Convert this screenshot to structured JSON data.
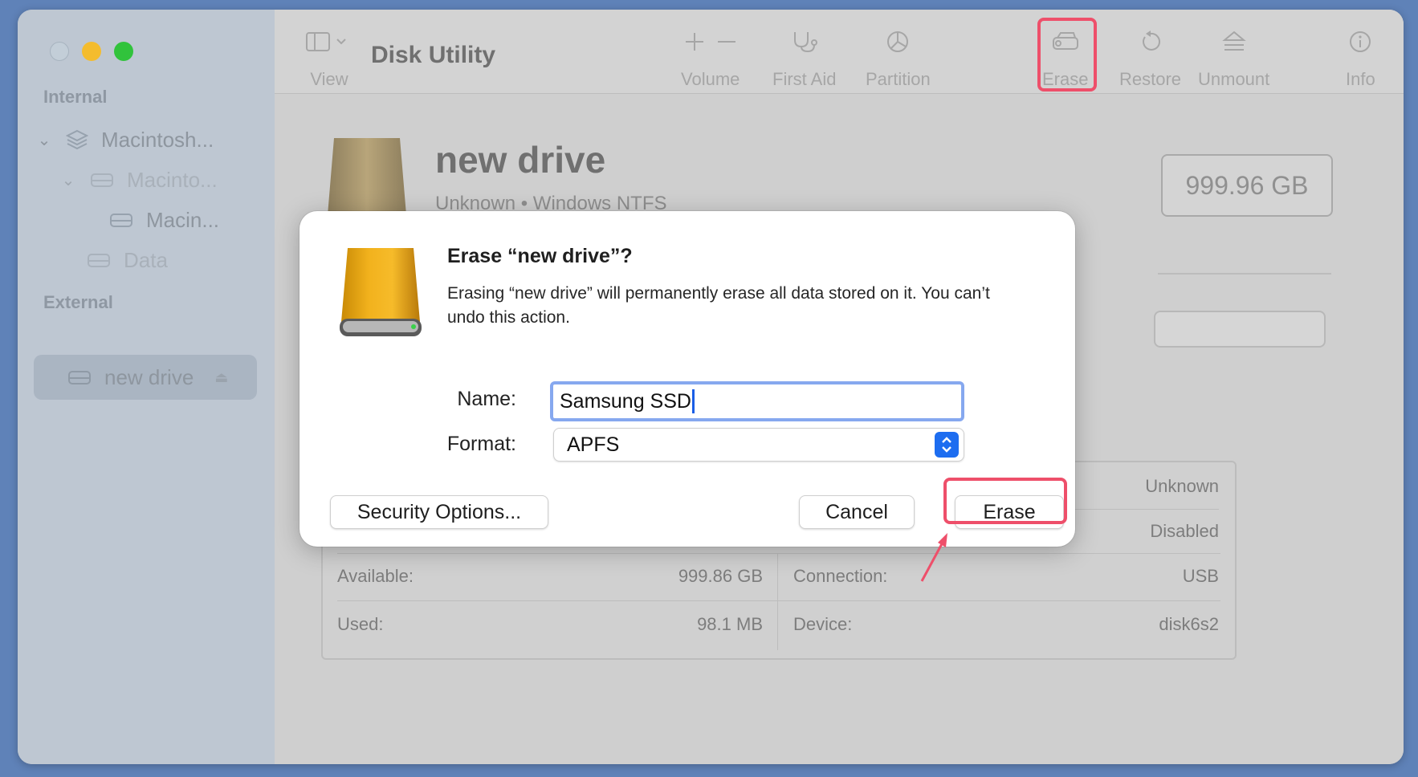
{
  "window": {
    "app_title": "Disk Utility"
  },
  "sidebar": {
    "internal_label": "Internal",
    "external_label": "External",
    "items": [
      {
        "label": "Macintosh..."
      },
      {
        "label": "Macinto..."
      },
      {
        "label": "Macin..."
      },
      {
        "label": "Data"
      },
      {
        "label": "new drive"
      }
    ]
  },
  "toolbar": {
    "view_label": "View",
    "volume_label": "Volume",
    "first_aid_label": "First Aid",
    "partition_label": "Partition",
    "erase_label": "Erase",
    "restore_label": "Restore",
    "unmount_label": "Unmount",
    "info_label": "Info"
  },
  "drive": {
    "name": "new drive",
    "subtitle": "Unknown • Windows NTFS",
    "capacity": "999.96 GB"
  },
  "info": {
    "rows": [
      {
        "label": "",
        "value": "Unknown"
      },
      {
        "label": "",
        "value": "Disabled"
      },
      {
        "label": "Available:",
        "value": "999.86 GB"
      },
      {
        "label": "Connection:",
        "value": "USB"
      },
      {
        "label": "Used:",
        "value": "98.1 MB"
      },
      {
        "label": "Device:",
        "value": "disk6s2"
      }
    ]
  },
  "dialog": {
    "title": "Erase “new drive”?",
    "message": "Erasing “new drive” will permanently erase all data stored on it. You can’t undo this action.",
    "name_label": "Name:",
    "name_value": "Samsung SSD",
    "format_label": "Format:",
    "format_value": "APFS",
    "security_button": "Security Options...",
    "cancel_button": "Cancel",
    "erase_button": "Erase"
  },
  "colors": {
    "highlight": "#ee4f6a",
    "accent": "#1d6df0",
    "focus_ring": "#86a8ef"
  }
}
